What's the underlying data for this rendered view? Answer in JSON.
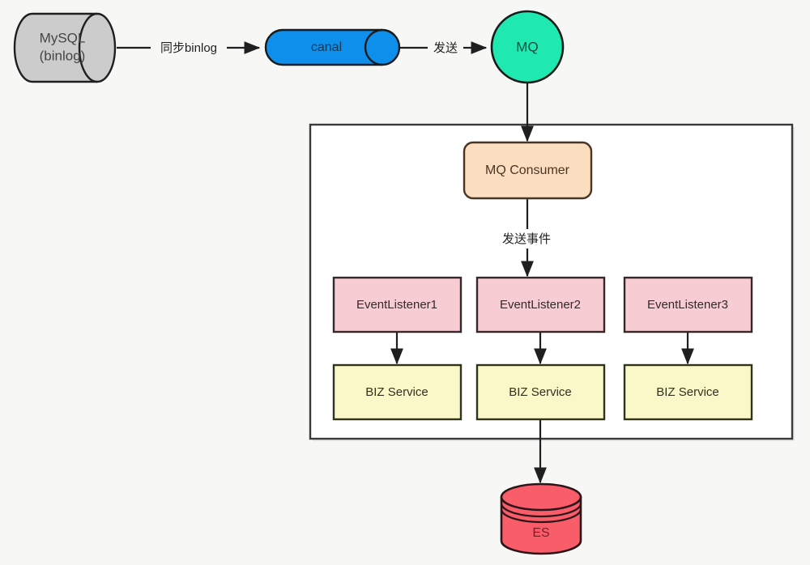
{
  "diagram": {
    "title": "MySQL binlog to ES sync architecture",
    "background_color": "#f7f7f5",
    "line_color": "#1f1f1f",
    "nodes": {
      "mysql": {
        "label_line1": "MySQL",
        "label_line2": "(binlog)",
        "shape": "cylinder-horizontal",
        "fill": "#cccccc",
        "stroke": "#1f1f1f",
        "text_color": "#444444"
      },
      "canal": {
        "label": "canal",
        "shape": "cylinder-horizontal",
        "fill": "#0e8fec",
        "stroke": "#1a1a1a",
        "text_color": "#123a56"
      },
      "mq": {
        "label": "MQ",
        "shape": "circle",
        "fill": "#1fe8b0",
        "stroke": "#1a1a1a",
        "text_color": "#1a4a3c"
      },
      "mq_consumer": {
        "label": "MQ Consumer",
        "shape": "rounded-rect",
        "fill": "#fbddc0",
        "stroke": "#4a3522",
        "text_color": "#4a3522"
      },
      "event_listener_1": {
        "label": "EventListener1",
        "shape": "rect",
        "fill": "#f7cdd3",
        "stroke": "#33292b",
        "text_color": "#33292b"
      },
      "event_listener_2": {
        "label": "EventListener2",
        "shape": "rect",
        "fill": "#f7cdd3",
        "stroke": "#33292b",
        "text_color": "#33292b"
      },
      "event_listener_3": {
        "label": "EventListener3",
        "shape": "rect",
        "fill": "#f7cdd3",
        "stroke": "#33292b",
        "text_color": "#33292b"
      },
      "biz_service_1": {
        "label": "BIZ Service",
        "shape": "rect",
        "fill": "#faf7c8",
        "stroke": "#32331f",
        "text_color": "#32331f"
      },
      "biz_service_2": {
        "label": "BIZ Service",
        "shape": "rect",
        "fill": "#faf7c8",
        "stroke": "#32331f",
        "text_color": "#32331f"
      },
      "biz_service_3": {
        "label": "BIZ Service",
        "shape": "rect",
        "fill": "#faf7c8",
        "stroke": "#32331f",
        "text_color": "#32331f"
      },
      "es": {
        "label": "ES",
        "shape": "cylinder-vertical",
        "fill": "#f95d6a",
        "stroke": "#2b1518",
        "text_color": "#7a1f26"
      },
      "container": {
        "label": "",
        "shape": "rect",
        "fill": "#ffffff",
        "stroke": "#3a3a3a"
      }
    },
    "edges": [
      {
        "id": "mysql-to-canal",
        "label": "同步binlog",
        "from": "mysql",
        "to": "canal"
      },
      {
        "id": "canal-to-mq",
        "label": "发送",
        "from": "canal",
        "to": "mq"
      },
      {
        "id": "mq-to-consumer",
        "label": "",
        "from": "mq",
        "to": "mq_consumer"
      },
      {
        "id": "consumer-to-listeners",
        "label": "发送事件",
        "from": "mq_consumer",
        "to": "event_listener_2"
      },
      {
        "id": "listener1-to-biz1",
        "label": "",
        "from": "event_listener_1",
        "to": "biz_service_1"
      },
      {
        "id": "listener2-to-biz2",
        "label": "",
        "from": "event_listener_2",
        "to": "biz_service_2"
      },
      {
        "id": "listener3-to-biz3",
        "label": "",
        "from": "event_listener_3",
        "to": "biz_service_3"
      },
      {
        "id": "biz2-to-es",
        "label": "",
        "from": "biz_service_2",
        "to": "es"
      }
    ]
  }
}
